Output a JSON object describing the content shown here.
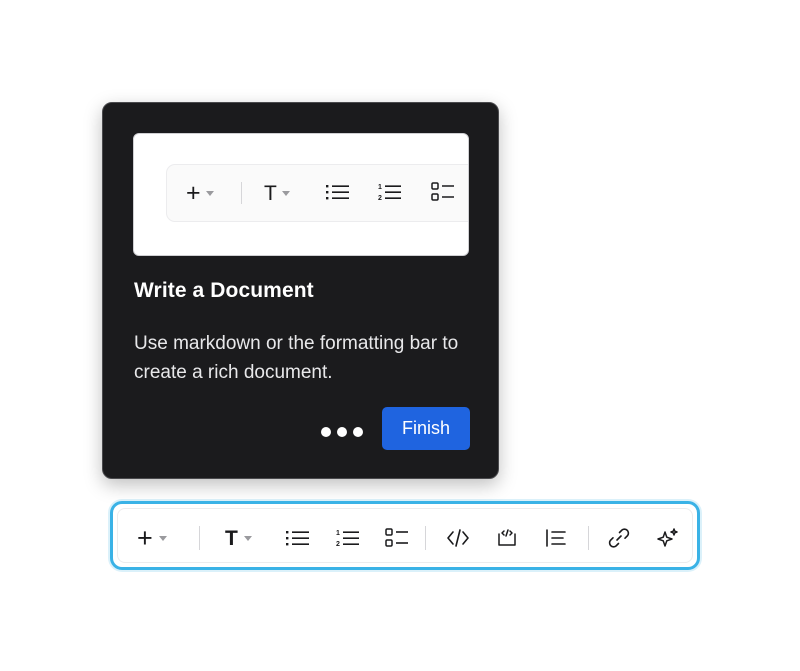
{
  "tour_card": {
    "title": "Write a Document",
    "body": "Use markdown or the formatting bar to create a rich document.",
    "finish_label": "Finish",
    "step_dots": 3
  },
  "toolbar": {
    "insert_icon": "plus-icon",
    "text_style_icon": "text-type-icon",
    "text_style_glyph": "T",
    "items": [
      "bulleted-list-icon",
      "numbered-list-icon",
      "checklist-icon",
      "code-icon",
      "code-block-icon",
      "blockquote-icon",
      "link-icon",
      "ai-sparkle-icon"
    ]
  },
  "colors": {
    "card_bg": "#1b1b1d",
    "finish_button": "#1f64e0",
    "toolbar_highlight": "#3ab2e6"
  }
}
